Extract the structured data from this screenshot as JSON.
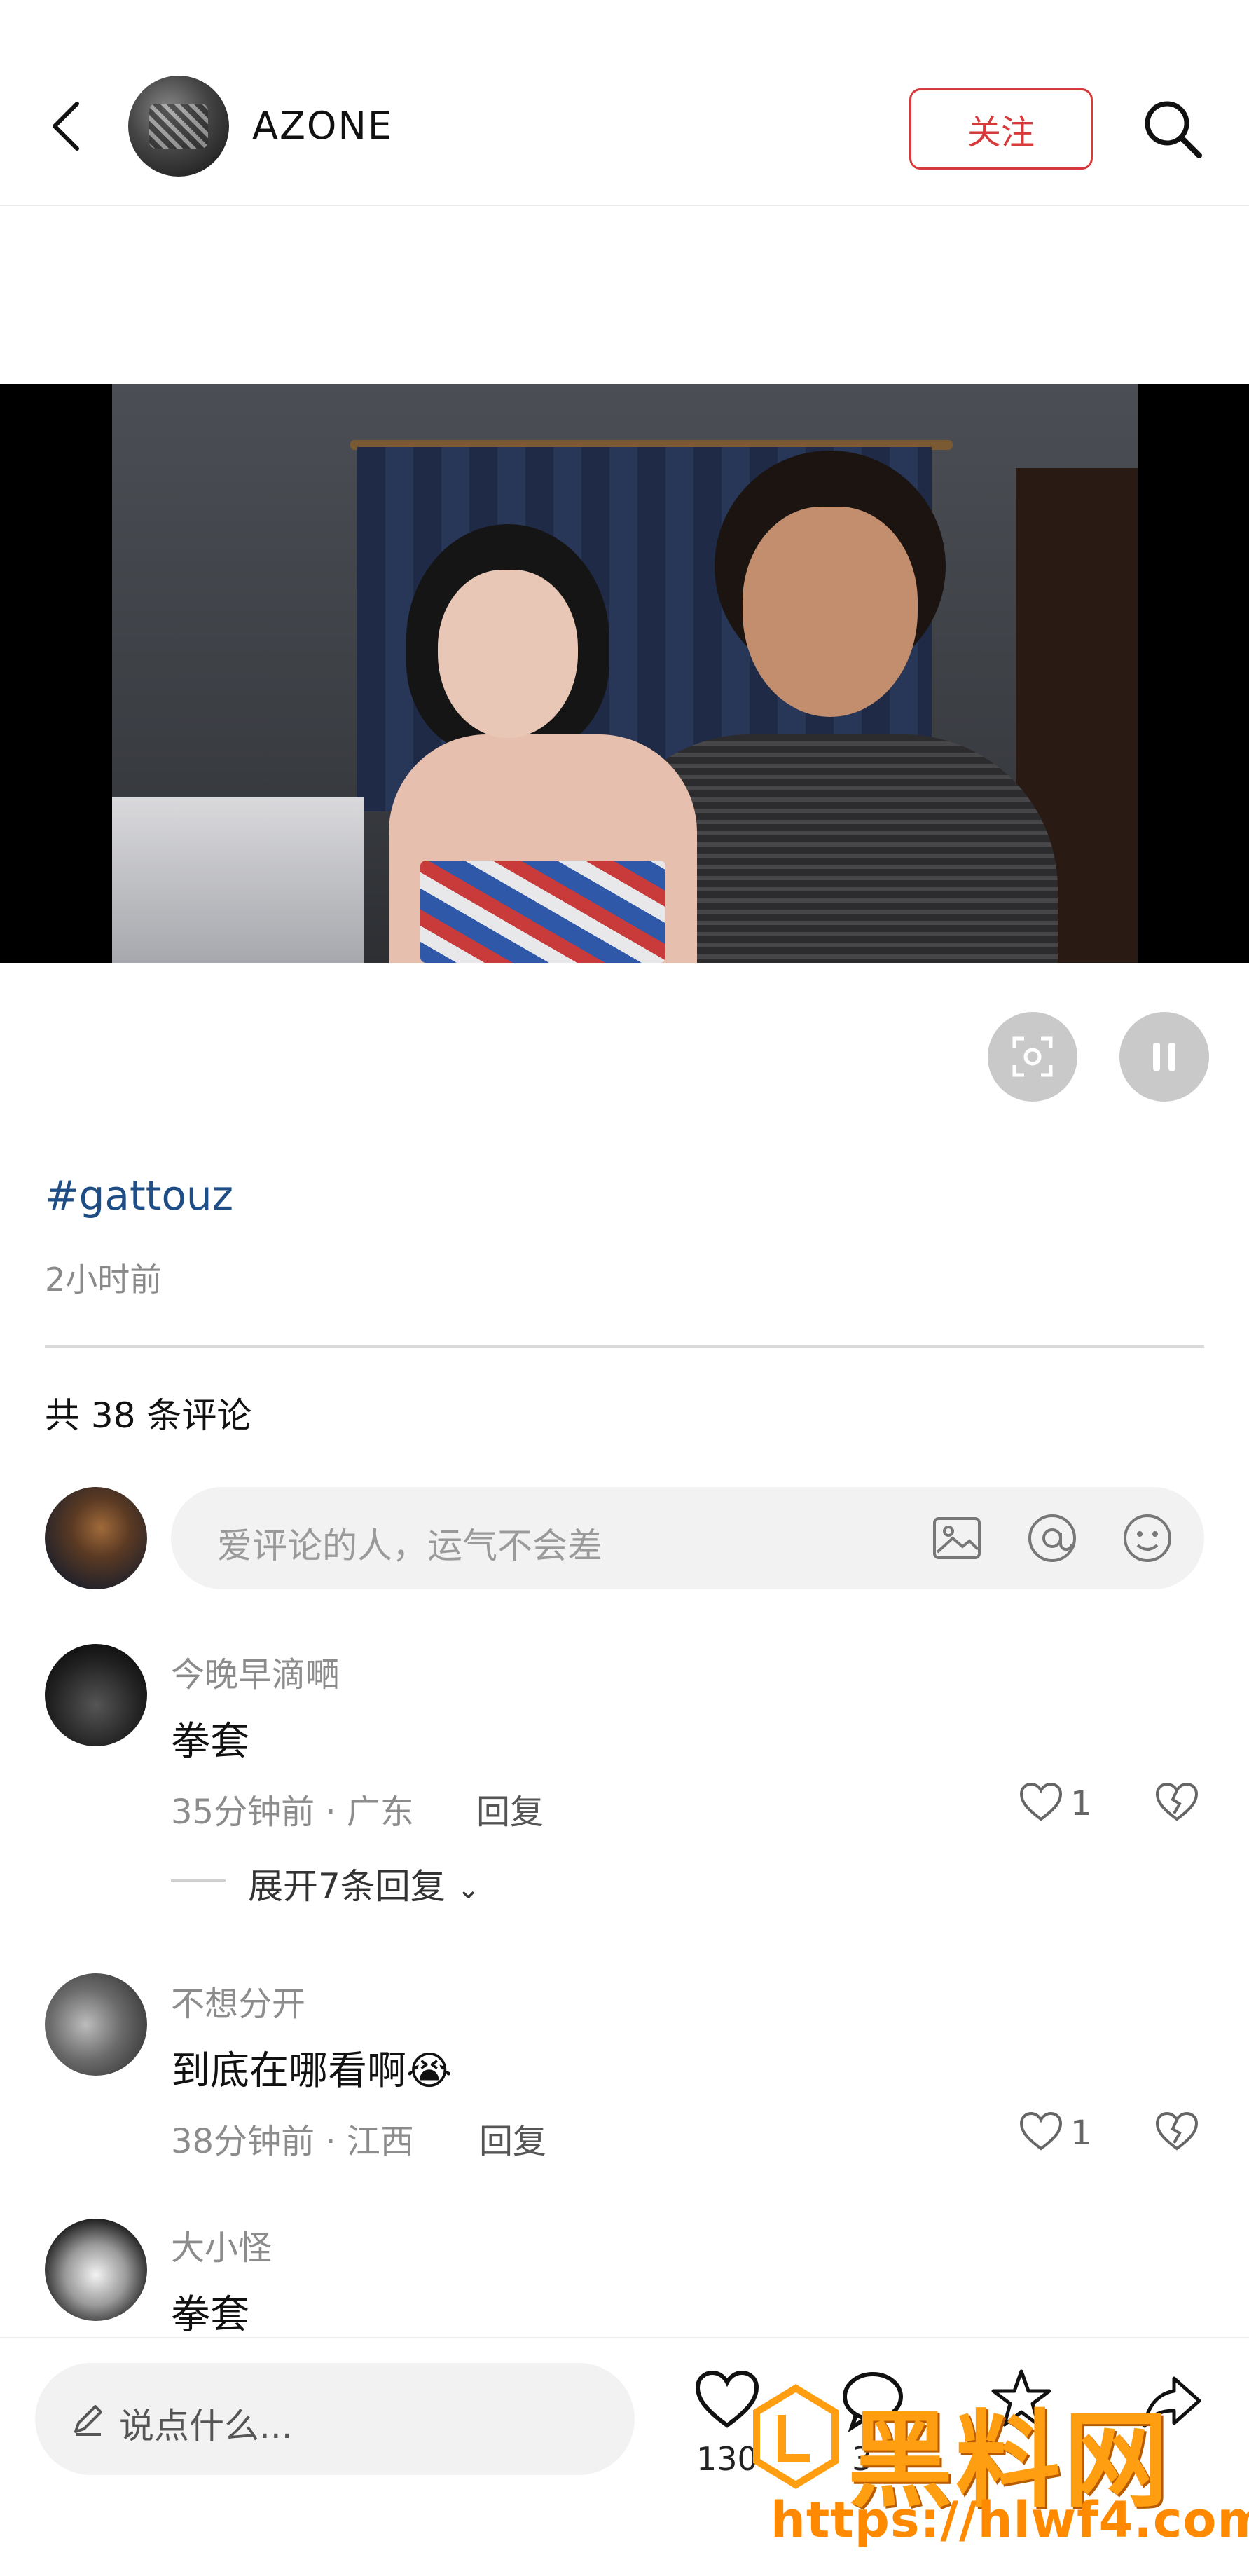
{
  "header": {
    "author_name": "AZONE",
    "follow_label": "关注"
  },
  "post": {
    "hashtag": "#gattouz",
    "time_ago": "2小时前"
  },
  "comments_section": {
    "count_text": "共 38 条评论",
    "input_placeholder": "爱评论的人，运气不会差"
  },
  "comments": [
    {
      "name": "今晚早滴嗮",
      "text": "拳套",
      "meta": "35分钟前 · 广东",
      "reply_label": "回复",
      "likes": "1",
      "expand_text": "展开7条回复"
    },
    {
      "name": "不想分开",
      "text": "到底在哪看啊😭",
      "meta": "38分钟前 · 江西",
      "reply_label": "回复",
      "likes": "1"
    },
    {
      "name": "大小怪",
      "text": "拳套"
    }
  ],
  "bottom_bar": {
    "say_placeholder": "说点什么...",
    "like_count": "130",
    "comment_count": "3",
    "collect_count": "",
    "share_count": ""
  },
  "watermark": {
    "brand_text": "黑料网",
    "url": "https://hlwf4.com"
  },
  "colors": {
    "accent": "#d63a3a",
    "hashtag": "#1f4e87",
    "watermark": "#ff9e10"
  }
}
